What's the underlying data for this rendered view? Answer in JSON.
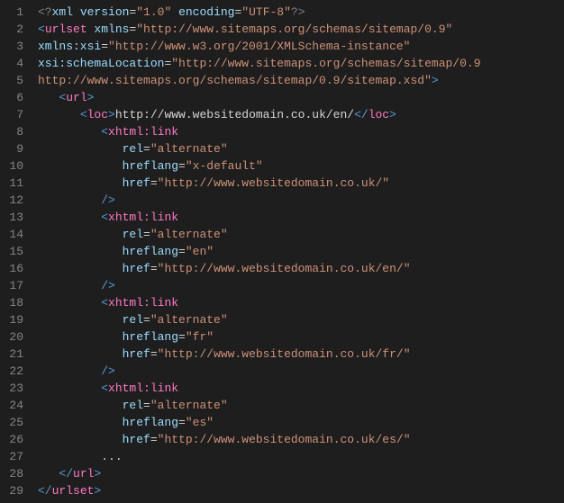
{
  "lines": [
    {
      "n": "1",
      "segs": [
        [
          "pi",
          "<?"
        ],
        [
          "attr-name",
          "xml version"
        ],
        [
          "eq",
          "="
        ],
        [
          "attr-val",
          "\"1.0\""
        ],
        [
          "attr-name",
          " encoding"
        ],
        [
          "eq",
          "="
        ],
        [
          "attr-val",
          "\"UTF-8\""
        ],
        [
          "pi",
          "?>"
        ]
      ]
    },
    {
      "n": "2",
      "segs": [
        [
          "tag",
          "<"
        ],
        [
          "elem",
          "urlset"
        ],
        [
          "attr-name",
          " xmlns"
        ],
        [
          "eq",
          "="
        ],
        [
          "attr-val",
          "\"http://www.sitemaps.org/schemas/sitemap/0.9\""
        ]
      ]
    },
    {
      "n": "3",
      "segs": [
        [
          "attr-name",
          "xmlns:xsi"
        ],
        [
          "eq",
          "="
        ],
        [
          "attr-val",
          "\"http://www.w3.org/2001/XMLSchema-instance\""
        ]
      ]
    },
    {
      "n": "4",
      "segs": [
        [
          "attr-name",
          "xsi:schemaLocation"
        ],
        [
          "eq",
          "="
        ],
        [
          "attr-val",
          "\"http://www.sitemaps.org/schemas/sitemap/0.9"
        ]
      ]
    },
    {
      "n": "5",
      "segs": [
        [
          "attr-val",
          "http://www.sitemaps.org/schemas/sitemap/0.9/sitemap.xsd\""
        ],
        [
          "tag",
          ">"
        ]
      ]
    },
    {
      "n": "6",
      "segs": [
        [
          "xml-text",
          "   "
        ],
        [
          "tag",
          "<"
        ],
        [
          "elem",
          "url"
        ],
        [
          "tag",
          ">"
        ]
      ]
    },
    {
      "n": "7",
      "segs": [
        [
          "xml-text",
          "      "
        ],
        [
          "tag",
          "<"
        ],
        [
          "elem",
          "loc"
        ],
        [
          "tag",
          ">"
        ],
        [
          "xml-text",
          "http://www.websitedomain.co.uk/en/"
        ],
        [
          "tag",
          "</"
        ],
        [
          "elem",
          "loc"
        ],
        [
          "tag",
          ">"
        ]
      ]
    },
    {
      "n": "8",
      "segs": [
        [
          "xml-text",
          "         "
        ],
        [
          "tag",
          "<"
        ],
        [
          "elem",
          "xhtml:link"
        ]
      ]
    },
    {
      "n": "9",
      "segs": [
        [
          "xml-text",
          "            "
        ],
        [
          "attr-name",
          "rel"
        ],
        [
          "eq",
          "="
        ],
        [
          "attr-val",
          "\"alternate\""
        ]
      ]
    },
    {
      "n": "10",
      "segs": [
        [
          "xml-text",
          "            "
        ],
        [
          "attr-name",
          "hreflang"
        ],
        [
          "eq",
          "="
        ],
        [
          "attr-val",
          "\"x-default\""
        ]
      ]
    },
    {
      "n": "11",
      "segs": [
        [
          "xml-text",
          "            "
        ],
        [
          "attr-name",
          "href"
        ],
        [
          "eq",
          "="
        ],
        [
          "attr-val",
          "\"http://www.websitedomain.co.uk/\""
        ]
      ]
    },
    {
      "n": "12",
      "segs": [
        [
          "xml-text",
          "         "
        ],
        [
          "tag",
          "/>"
        ]
      ]
    },
    {
      "n": "13",
      "segs": [
        [
          "xml-text",
          "         "
        ],
        [
          "tag",
          "<"
        ],
        [
          "elem",
          "xhtml:link"
        ]
      ]
    },
    {
      "n": "14",
      "segs": [
        [
          "xml-text",
          "            "
        ],
        [
          "attr-name",
          "rel"
        ],
        [
          "eq",
          "="
        ],
        [
          "attr-val",
          "\"alternate\""
        ]
      ]
    },
    {
      "n": "15",
      "segs": [
        [
          "xml-text",
          "            "
        ],
        [
          "attr-name",
          "hreflang"
        ],
        [
          "eq",
          "="
        ],
        [
          "attr-val",
          "\"en\""
        ]
      ]
    },
    {
      "n": "16",
      "segs": [
        [
          "xml-text",
          "            "
        ],
        [
          "attr-name",
          "href"
        ],
        [
          "eq",
          "="
        ],
        [
          "attr-val",
          "\"http://www.websitedomain.co.uk/en/\""
        ]
      ]
    },
    {
      "n": "17",
      "segs": [
        [
          "xml-text",
          "         "
        ],
        [
          "tag",
          "/>"
        ]
      ]
    },
    {
      "n": "18",
      "segs": [
        [
          "xml-text",
          "         "
        ],
        [
          "tag",
          "<"
        ],
        [
          "elem",
          "xhtml:link"
        ]
      ]
    },
    {
      "n": "19",
      "segs": [
        [
          "xml-text",
          "            "
        ],
        [
          "attr-name",
          "rel"
        ],
        [
          "eq",
          "="
        ],
        [
          "attr-val",
          "\"alternate\""
        ]
      ]
    },
    {
      "n": "20",
      "segs": [
        [
          "xml-text",
          "            "
        ],
        [
          "attr-name",
          "hreflang"
        ],
        [
          "eq",
          "="
        ],
        [
          "attr-val",
          "\"fr\""
        ]
      ]
    },
    {
      "n": "21",
      "segs": [
        [
          "xml-text",
          "            "
        ],
        [
          "attr-name",
          "href"
        ],
        [
          "eq",
          "="
        ],
        [
          "attr-val",
          "\"http://www.websitedomain.co.uk/fr/\""
        ]
      ]
    },
    {
      "n": "22",
      "segs": [
        [
          "xml-text",
          "         "
        ],
        [
          "tag",
          "/>"
        ]
      ]
    },
    {
      "n": "23",
      "segs": [
        [
          "xml-text",
          "         "
        ],
        [
          "tag",
          "<"
        ],
        [
          "elem",
          "xhtml:link"
        ]
      ]
    },
    {
      "n": "24",
      "segs": [
        [
          "xml-text",
          "            "
        ],
        [
          "attr-name",
          "rel"
        ],
        [
          "eq",
          "="
        ],
        [
          "attr-val",
          "\"alternate\""
        ]
      ]
    },
    {
      "n": "25",
      "segs": [
        [
          "xml-text",
          "            "
        ],
        [
          "attr-name",
          "hreflang"
        ],
        [
          "eq",
          "="
        ],
        [
          "attr-val",
          "\"es\""
        ]
      ]
    },
    {
      "n": "26",
      "segs": [
        [
          "xml-text",
          "            "
        ],
        [
          "attr-name",
          "href"
        ],
        [
          "eq",
          "="
        ],
        [
          "attr-val",
          "\"http://www.websitedomain.co.uk/es/\""
        ]
      ]
    },
    {
      "n": "27",
      "segs": [
        [
          "xml-text",
          "         ..."
        ]
      ]
    },
    {
      "n": "28",
      "segs": [
        [
          "xml-text",
          "   "
        ],
        [
          "tag",
          "</"
        ],
        [
          "elem",
          "url"
        ],
        [
          "tag",
          ">"
        ]
      ]
    },
    {
      "n": "29",
      "segs": [
        [
          "tag",
          "</"
        ],
        [
          "elem",
          "urlset"
        ],
        [
          "tag",
          ">"
        ]
      ]
    }
  ]
}
